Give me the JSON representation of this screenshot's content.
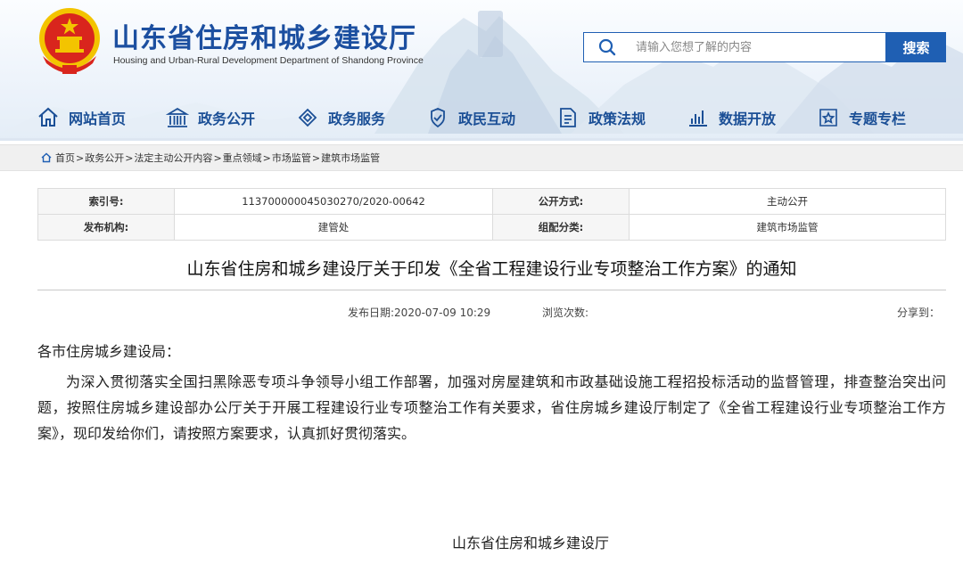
{
  "header": {
    "title": "山东省住房和城乡建设厅",
    "subtitle": "Housing and Urban-Rural Development Department of Shandong Province",
    "brand_color": "#1c4fa0",
    "emblem_color": "#d9251d",
    "emblem_gold": "#f3c400"
  },
  "search": {
    "placeholder": "请输入您想了解的内容",
    "button_label": "搜索",
    "icon": "search-icon"
  },
  "nav": {
    "items": [
      {
        "label": "网站首页",
        "icon": "home-icon"
      },
      {
        "label": "政务公开",
        "icon": "building-icon"
      },
      {
        "label": "政务服务",
        "icon": "handshake-icon"
      },
      {
        "label": "政民互动",
        "icon": "interaction-icon"
      },
      {
        "label": "政策法规",
        "icon": "document-icon"
      },
      {
        "label": "数据开放",
        "icon": "bar-chart-icon"
      },
      {
        "label": "专题专栏",
        "icon": "topic-icon"
      }
    ]
  },
  "breadcrumb": {
    "items": [
      "首页",
      "政务公开",
      "法定主动公开内容",
      "重点领域",
      "市场监管",
      "建筑市场监管"
    ],
    "separator": ">"
  },
  "info": {
    "index_label": "索引号:",
    "index_value": "113700000045030270/2020-00642",
    "disclosure_label": "公开方式:",
    "disclosure_value": "主动公开",
    "issuer_label": "发布机构:",
    "issuer_value": "建管处",
    "category_label": "组配分类:",
    "category_value": "建筑市场监管"
  },
  "article": {
    "title": "山东省住房和城乡建设厅关于印发《全省工程建设行业专项整治工作方案》的通知",
    "publish_date": "发布日期:2020-07-09 10:29",
    "views": "浏览次数:",
    "share": "分享到：",
    "salutation": "各市住房城乡建设局：",
    "body": "为深入贯彻落实全国扫黑除恶专项斗争领导小组工作部署，加强对房屋建筑和市政基础设施工程招投标活动的监督管理，排查整治突出问题，按照住房城乡建设部办公厅关于开展工程建设行业专项整治工作有关要求，省住房城乡建设厅制定了《全省工程建设行业专项整治工作方案》，现印发给你们，请按照方案要求，认真抓好贯彻落实。",
    "signature": "山东省住房和城乡建设厅"
  }
}
